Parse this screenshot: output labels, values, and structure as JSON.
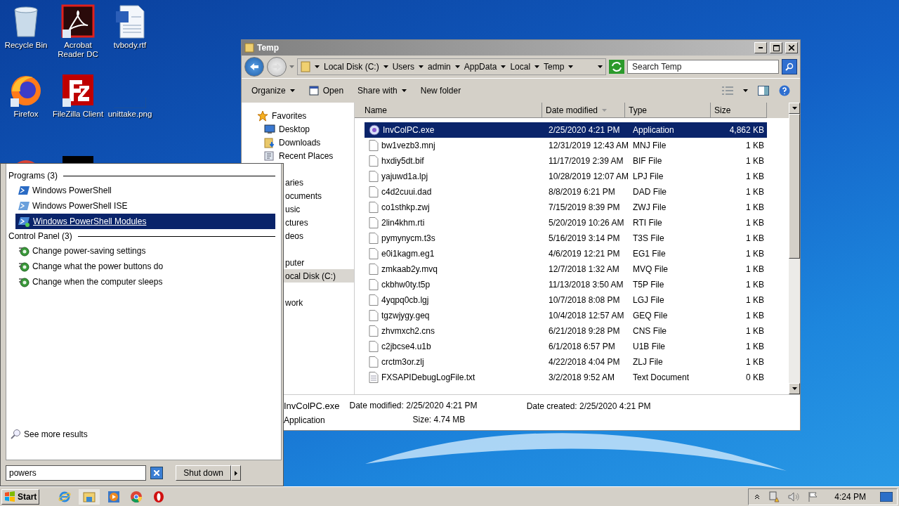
{
  "desktop_icons": [
    {
      "kind": "recycle",
      "label": "Recycle Bin"
    },
    {
      "kind": "acrobat",
      "label": "Acrobat Reader DC"
    },
    {
      "kind": "word",
      "label": "tvbody.rtf"
    },
    {
      "kind": "firefox",
      "label": "Firefox"
    },
    {
      "kind": "filezilla",
      "label": "FileZilla Client"
    },
    {
      "kind": "blank",
      "label": "unittake.png"
    },
    {
      "kind": "chrome"
    },
    {
      "kind": "dark"
    }
  ],
  "explorer": {
    "title": "Temp",
    "breadcrumbs": [
      "Local Disk (C:)",
      "Users",
      "admin",
      "AppData",
      "Local",
      "Temp"
    ],
    "search": {
      "placeholder": "Search Temp"
    },
    "toolbar": [
      {
        "kind": "menu",
        "label": "Organize"
      },
      {
        "kind": "icon",
        "label": "Open"
      },
      {
        "kind": "menu",
        "label": "Share with"
      },
      {
        "kind": "plain",
        "label": "New folder"
      }
    ],
    "nav": [
      {
        "kind": "header",
        "label": "Favorites",
        "selected": false
      },
      {
        "kind": "desktop",
        "label": "Desktop",
        "selected": false
      },
      {
        "kind": "downloads",
        "label": "Downloads",
        "selected": false
      },
      {
        "kind": "recent",
        "label": "Recent Places",
        "selected": false
      },
      {
        "kind": "gap"
      },
      {
        "kind": "fragment",
        "label": "aries",
        "selected": false
      },
      {
        "kind": "fragment",
        "label": "ocuments",
        "selected": false
      },
      {
        "kind": "fragment",
        "label": "usic",
        "selected": false
      },
      {
        "kind": "fragment",
        "label": "ctures",
        "selected": false
      },
      {
        "kind": "fragment",
        "label": "deos",
        "selected": false
      },
      {
        "kind": "gap"
      },
      {
        "kind": "fragment",
        "label": "puter",
        "selected": false
      },
      {
        "kind": "fragment",
        "label": "ocal Disk (C:)",
        "selected": true
      },
      {
        "kind": "gap"
      },
      {
        "kind": "fragment",
        "label": "work",
        "selected": false
      }
    ],
    "columns": [
      {
        "label": "Name",
        "sorted": false
      },
      {
        "label": "Date modified",
        "sorted": true
      },
      {
        "label": "Type",
        "sorted": false
      },
      {
        "label": "Size",
        "sorted": false
      }
    ],
    "rows": [
      {
        "kind": "app",
        "name": "InvColPC.exe",
        "date": "2/25/2020 4:21 PM",
        "type": "Application",
        "size": "4,862 KB",
        "selected": true
      },
      {
        "kind": "file",
        "name": "bw1vezb3.mnj",
        "date": "12/31/2019 12:43 AM",
        "type": "MNJ File",
        "size": "1 KB",
        "selected": false
      },
      {
        "kind": "file",
        "name": "hxdiy5dt.bif",
        "date": "11/17/2019 2:39 AM",
        "type": "BIF File",
        "size": "1 KB",
        "selected": false
      },
      {
        "kind": "file",
        "name": "yajuwd1a.lpj",
        "date": "10/28/2019 12:07 AM",
        "type": "LPJ File",
        "size": "1 KB",
        "selected": false
      },
      {
        "kind": "file",
        "name": "c4d2cuui.dad",
        "date": "8/8/2019 6:21 PM",
        "type": "DAD File",
        "size": "1 KB",
        "selected": false
      },
      {
        "kind": "file",
        "name": "co1sthkp.zwj",
        "date": "7/15/2019 8:39 PM",
        "type": "ZWJ File",
        "size": "1 KB",
        "selected": false
      },
      {
        "kind": "file",
        "name": "2lin4khm.rti",
        "date": "5/20/2019 10:26 AM",
        "type": "RTI File",
        "size": "1 KB",
        "selected": false
      },
      {
        "kind": "file",
        "name": "pymynycm.t3s",
        "date": "5/16/2019 3:14 PM",
        "type": "T3S File",
        "size": "1 KB",
        "selected": false
      },
      {
        "kind": "file",
        "name": "e0i1kagm.eg1",
        "date": "4/6/2019 12:21 PM",
        "type": "EG1 File",
        "size": "1 KB",
        "selected": false
      },
      {
        "kind": "file",
        "name": "zmkaab2y.mvq",
        "date": "12/7/2018 1:32 AM",
        "type": "MVQ File",
        "size": "1 KB",
        "selected": false
      },
      {
        "kind": "file",
        "name": "ckbhw0ty.t5p",
        "date": "11/13/2018 3:50 AM",
        "type": "T5P File",
        "size": "1 KB",
        "selected": false
      },
      {
        "kind": "file",
        "name": "4yqpq0cb.lgj",
        "date": "10/7/2018 8:08 PM",
        "type": "LGJ File",
        "size": "1 KB",
        "selected": false
      },
      {
        "kind": "file",
        "name": "tgzwjygy.geq",
        "date": "10/4/2018 12:57 AM",
        "type": "GEQ File",
        "size": "1 KB",
        "selected": false
      },
      {
        "kind": "file",
        "name": "zhvmxch2.cns",
        "date": "6/21/2018 9:28 PM",
        "type": "CNS File",
        "size": "1 KB",
        "selected": false
      },
      {
        "kind": "file",
        "name": "c2jbcse4.u1b",
        "date": "6/1/2018 6:57 PM",
        "type": "U1B File",
        "size": "1 KB",
        "selected": false
      },
      {
        "kind": "file",
        "name": "crctm3or.zlj",
        "date": "4/22/2018 4:04 PM",
        "type": "ZLJ File",
        "size": "1 KB",
        "selected": false
      },
      {
        "kind": "text",
        "name": "FXSAPIDebugLogFile.txt",
        "date": "3/2/2018 9:52 AM",
        "type": "Text Document",
        "size": "0 KB",
        "selected": false
      }
    ],
    "details": {
      "name": "InvColPC.exe",
      "type": "Application",
      "modified": {
        "label": "Date modified:",
        "value": "2/25/2020 4:21 PM"
      },
      "created": {
        "label": "Date created:",
        "value": "2/25/2020 4:21 PM"
      },
      "size": {
        "label": "Size:",
        "value": "4.74 MB"
      }
    }
  },
  "start_menu": {
    "groups": [
      {
        "title": "Programs (3)",
        "items": [
          {
            "kind": "powershell",
            "label": "Windows PowerShell",
            "selected": false
          },
          {
            "kind": "ise",
            "label": "Windows PowerShell ISE",
            "selected": false
          },
          {
            "kind": "modules",
            "label": "Windows PowerShell Modules",
            "selected": true
          }
        ]
      },
      {
        "title": "Control Panel (3)",
        "items": [
          {
            "kind": "power",
            "label": "Change power-saving settings",
            "selected": false
          },
          {
            "kind": "power",
            "label": "Change what the power buttons do",
            "selected": false
          },
          {
            "kind": "power",
            "label": "Change when the computer sleeps",
            "selected": false
          }
        ]
      }
    ],
    "more": "See more results",
    "search": {
      "value": "powers"
    },
    "shutdown": "Shut down"
  },
  "taskbar": {
    "start": "Start",
    "apps": [
      {
        "kind": "ie",
        "selected": false
      },
      {
        "kind": "explorer",
        "selected": true
      },
      {
        "kind": "media",
        "selected": false
      },
      {
        "kind": "chrome",
        "selected": false
      },
      {
        "kind": "opera",
        "selected": false
      }
    ],
    "clock": "4:24 PM"
  }
}
